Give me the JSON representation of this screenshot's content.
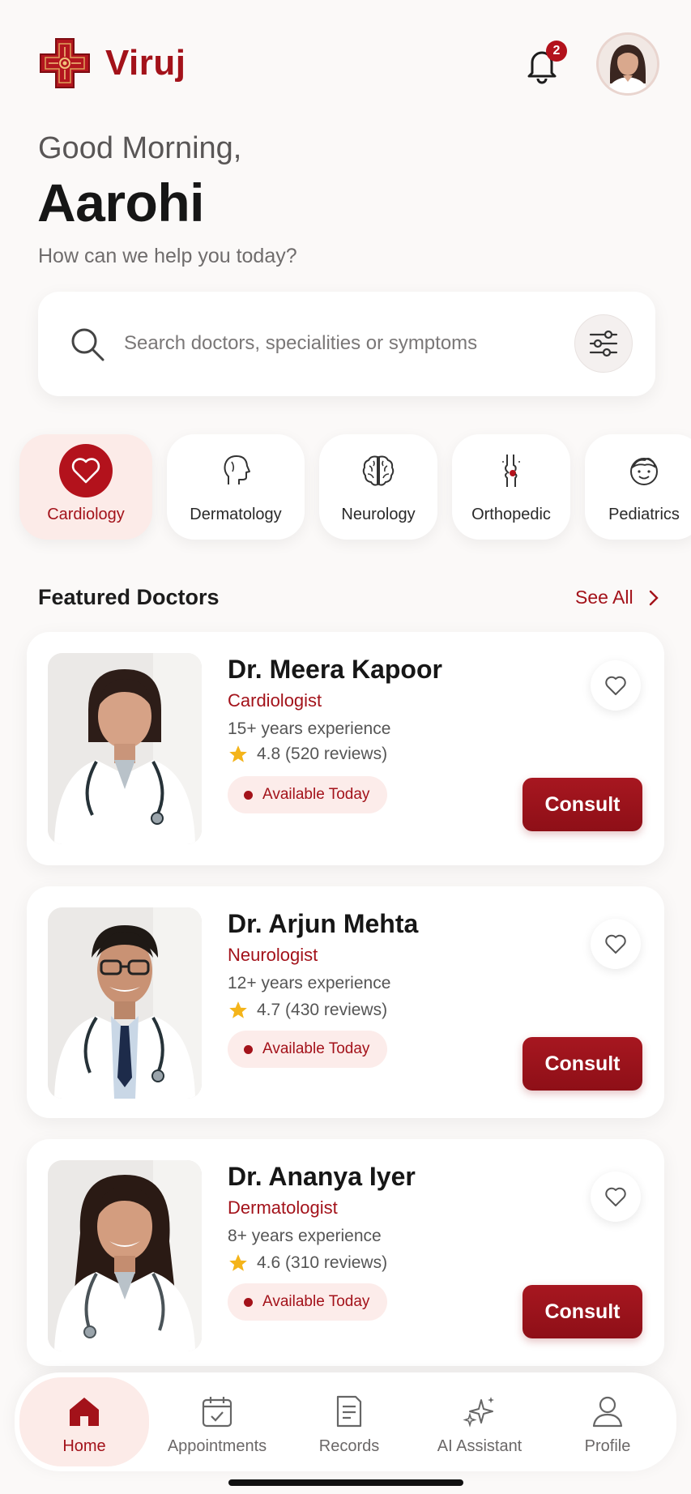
{
  "app": {
    "brand": "Viruj",
    "accent": "#a3121a"
  },
  "header": {
    "notification_count": "2"
  },
  "greeting": {
    "salutation": "Good Morning,",
    "name": "Aarohi",
    "prompt": "How can we help you today?"
  },
  "search": {
    "placeholder": "Search doctors, specialities or symptoms"
  },
  "categories": [
    {
      "label": "Cardiology",
      "icon": "heart-icon",
      "selected": true
    },
    {
      "label": "Dermatology",
      "icon": "face-profile-icon",
      "selected": false
    },
    {
      "label": "Neurology",
      "icon": "brain-icon",
      "selected": false
    },
    {
      "label": "Orthopedic",
      "icon": "bone-joint-icon",
      "selected": false
    },
    {
      "label": "Pediatrics",
      "icon": "child-face-icon",
      "selected": false
    }
  ],
  "featured": {
    "title": "Featured Doctors",
    "see_all": "See All"
  },
  "doctors": [
    {
      "name": "Dr. Meera Kapoor",
      "specialty": "Cardiologist",
      "experience": "15+ years experience",
      "rating": "4.8",
      "reviews": "(520 reviews)",
      "availability": "Available Today",
      "action": "Consult"
    },
    {
      "name": "Dr. Arjun Mehta",
      "specialty": "Neurologist",
      "experience": "12+ years experience",
      "rating": "4.7",
      "reviews": "(430 reviews)",
      "availability": "Available Today",
      "action": "Consult"
    },
    {
      "name": "Dr. Ananya Iyer",
      "specialty": "Dermatologist",
      "experience": "8+ years experience",
      "rating": "4.6",
      "reviews": "(310 reviews)",
      "availability": "Available Today",
      "action": "Consult"
    }
  ],
  "nav": [
    {
      "label": "Home",
      "icon": "home-icon",
      "active": true
    },
    {
      "label": "Appointments",
      "icon": "calendar-icon",
      "active": false
    },
    {
      "label": "Records",
      "icon": "document-icon",
      "active": false
    },
    {
      "label": "AI Assistant",
      "icon": "sparkle-icon",
      "active": false
    },
    {
      "label": "Profile",
      "icon": "person-icon",
      "active": false
    }
  ]
}
